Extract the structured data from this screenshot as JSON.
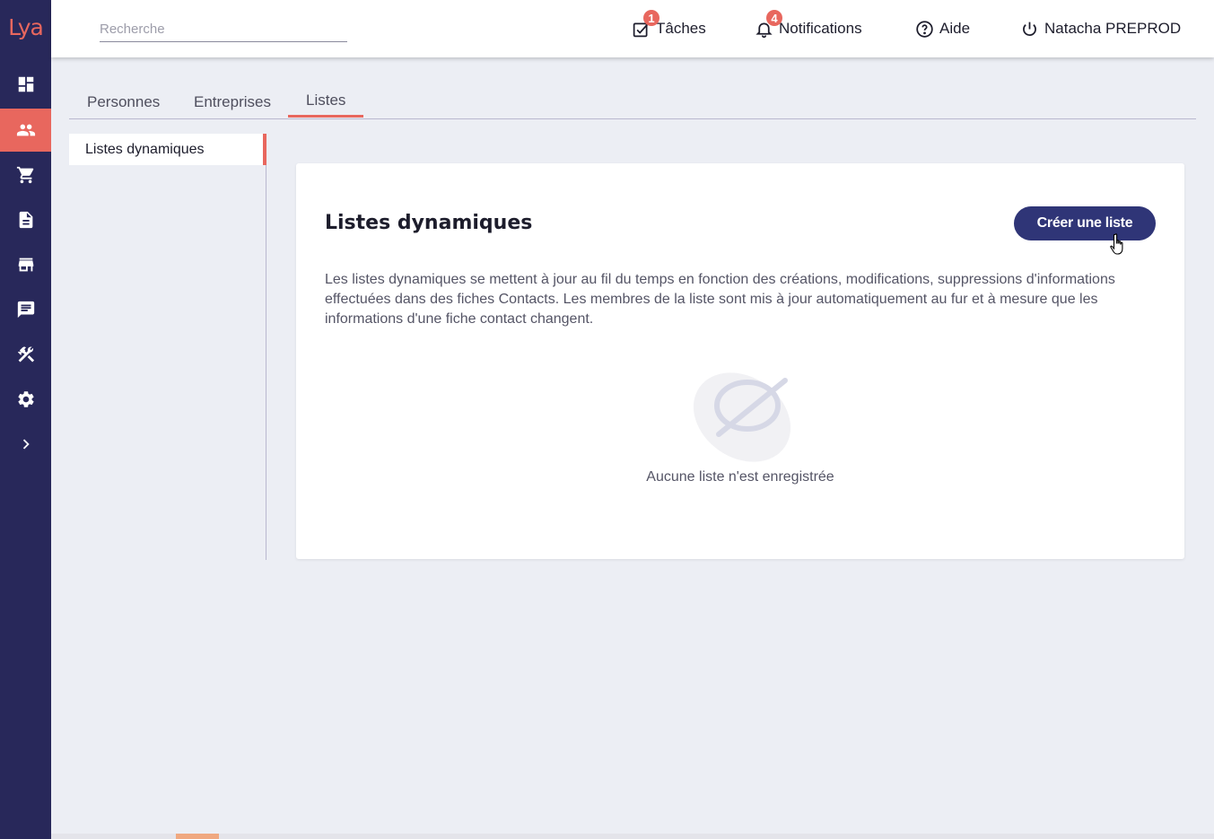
{
  "app": {
    "logo": "Lya"
  },
  "sidebar": {
    "items": [
      {
        "icon": "dashboard-icon",
        "active": false
      },
      {
        "icon": "people-icon",
        "active": true
      },
      {
        "icon": "cart-icon",
        "active": false
      },
      {
        "icon": "document-icon",
        "active": false
      },
      {
        "icon": "store-icon",
        "active": false
      },
      {
        "icon": "chat-icon",
        "active": false
      },
      {
        "icon": "tools-icon",
        "active": false
      },
      {
        "icon": "gear-icon",
        "active": false
      },
      {
        "icon": "chevron-right-icon",
        "active": false
      }
    ]
  },
  "header": {
    "search_placeholder": "Recherche",
    "tasks": {
      "label": "Tâches",
      "count": "1",
      "icon": "checkbox-icon"
    },
    "notifications": {
      "label": "Notifications",
      "count": "4",
      "icon": "bell-icon"
    },
    "help": {
      "label": "Aide",
      "icon": "help-icon"
    },
    "user": {
      "label": "Natacha PREPROD",
      "icon": "power-icon"
    }
  },
  "tabs": [
    {
      "label": "Personnes",
      "active": false
    },
    {
      "label": "Entreprises",
      "active": false
    },
    {
      "label": "Listes",
      "active": true
    }
  ],
  "submenu": {
    "items": [
      {
        "label": "Listes dynamiques",
        "active": true
      }
    ]
  },
  "card": {
    "title": "Listes dynamiques",
    "create_button": "Créer une liste",
    "description": "Les listes dynamiques se mettent à jour au fil du temps en fonction des créations, modifications, suppressions d'informations effectuées dans des fiches Contacts. Les membres de la liste sont mis à jour automatiquement au fur et à mesure que les informations d'une fiche contact changent.",
    "empty_message": "Aucune liste n'est enregistrée"
  },
  "colors": {
    "sidebar": "#28285a",
    "accent": "#e8675e",
    "primary_button": "#2f3577"
  }
}
